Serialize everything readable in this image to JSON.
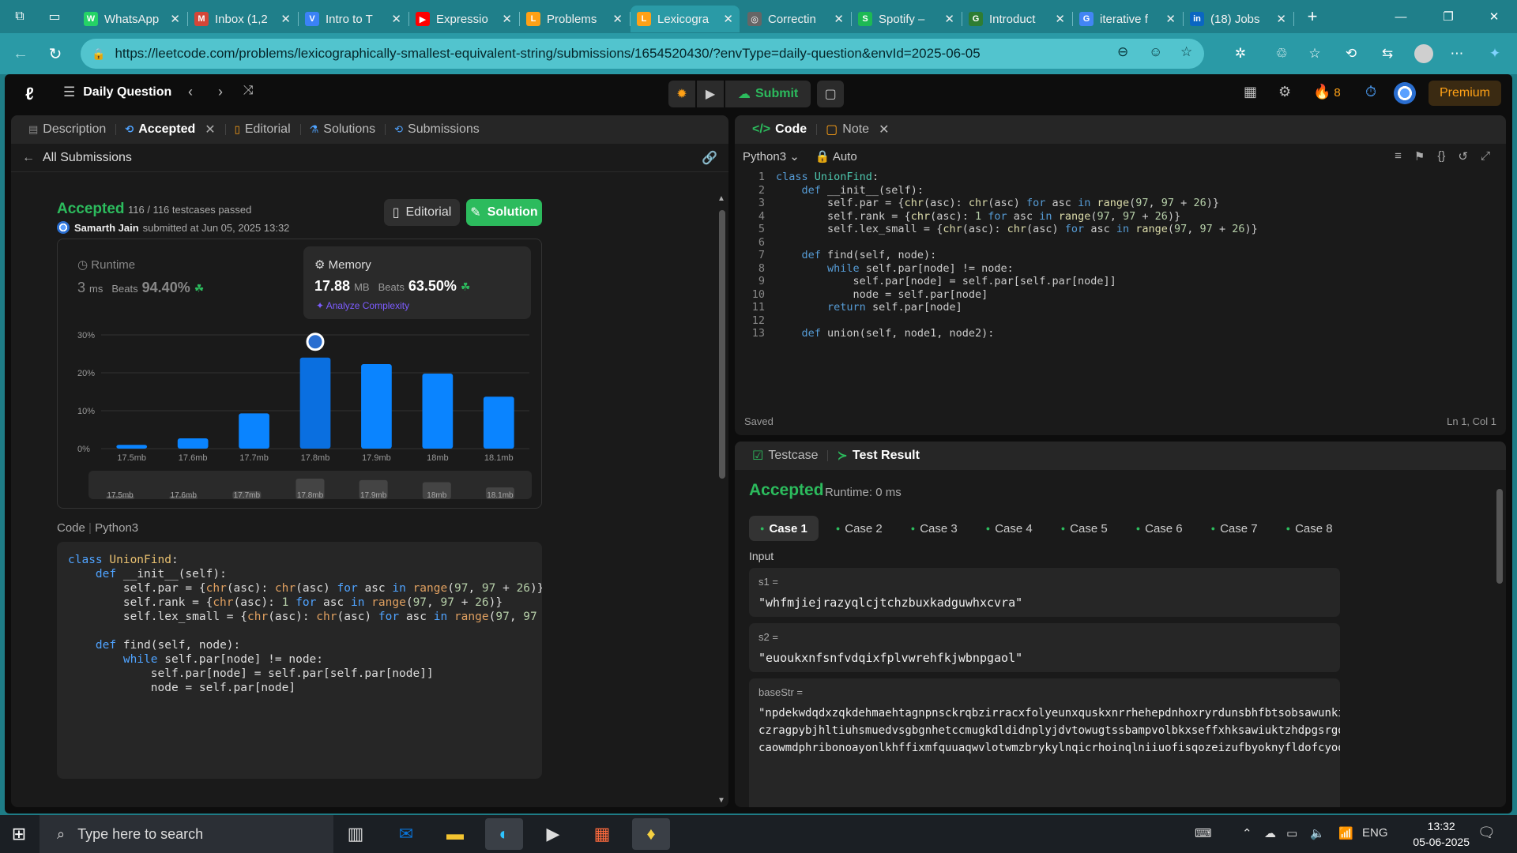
{
  "browser": {
    "tabs": [
      {
        "title": "WhatsApp",
        "favicon_color": "#25d366",
        "favicon": "W"
      },
      {
        "title": "Inbox (1,2",
        "favicon_color": "#d44638",
        "favicon": "M"
      },
      {
        "title": "Intro to T",
        "favicon_color": "#3b82f6",
        "favicon": "V"
      },
      {
        "title": "Expressio",
        "favicon_color": "#ff0000",
        "favicon": "▶"
      },
      {
        "title": "Problems",
        "favicon_color": "#ffa116",
        "favicon": "L"
      },
      {
        "title": "Lexicogra",
        "favicon_color": "#ffa116",
        "favicon": "L"
      },
      {
        "title": "Correctin",
        "favicon_color": "#666",
        "favicon": "◎"
      },
      {
        "title": "Spotify –",
        "favicon_color": "#1db954",
        "favicon": "S"
      },
      {
        "title": "Introduct",
        "favicon_color": "#2e7d32",
        "favicon": "G"
      },
      {
        "title": "iterative f",
        "favicon_color": "#4285f4",
        "favicon": "G"
      },
      {
        "title": "(18) Jobs",
        "favicon_color": "#0a66c2",
        "favicon": "in"
      }
    ],
    "active_tab_index": 5,
    "url": "https://leetcode.com/problems/lexicographically-smallest-equivalent-string/submissions/1654520430/?envType=daily-question&envId=2025-06-05"
  },
  "header": {
    "daily_question": "Daily Question",
    "submit_label": "Submit",
    "streak": "8",
    "premium": "Premium"
  },
  "left_panel": {
    "tabs": [
      {
        "label": "Description",
        "icon": "description-icon"
      },
      {
        "label": "Accepted",
        "icon": "history-icon"
      },
      {
        "label": "Editorial",
        "icon": "book-icon"
      },
      {
        "label": "Solutions",
        "icon": "flask-icon"
      },
      {
        "label": "Submissions",
        "icon": "history-icon"
      }
    ],
    "all_submissions": "All Submissions",
    "status": "Accepted",
    "testcases": "116 / 116 testcases passed",
    "user": "Samarth Jain",
    "submitted_at": "submitted at Jun 05, 2025 13:32",
    "editorial_btn": "Editorial",
    "solution_btn": "Solution",
    "runtime": {
      "label": "Runtime",
      "value": "3",
      "unit": "ms",
      "beats_label": "Beats",
      "beats": "94.40%"
    },
    "memory": {
      "label": "Memory",
      "value": "17.88",
      "unit": "MB",
      "beats_label": "Beats",
      "beats": "63.50%",
      "analyze": "Analyze Complexity"
    },
    "code_label": "Code",
    "code_lang": "Python3"
  },
  "chart_data": {
    "type": "bar",
    "categories": [
      "17.5mb",
      "17.6mb",
      "17.7mb",
      "17.8mb",
      "17.9mb",
      "18mb",
      "18.1mb"
    ],
    "values": [
      1,
      2.7,
      9.3,
      24,
      22.3,
      19.8,
      13.7
    ],
    "yticks": [
      "0%",
      "10%",
      "20%",
      "30%"
    ],
    "ylim": [
      0,
      30
    ],
    "highlight_category": "17.8mb",
    "bar_color": "#0a84ff",
    "grid": true
  },
  "code_editor": {
    "tabs": [
      "Code",
      "Note"
    ],
    "language": "Python3",
    "mode": "Auto",
    "saved": "Saved",
    "cursor": "Ln 1, Col 1",
    "lines": [
      "class UnionFind:",
      "    def __init__(self):",
      "        self.par = {chr(asc): chr(asc) for asc in range(97, 97 + 26)}",
      "        self.rank = {chr(asc): 1 for asc in range(97, 97 + 26)}",
      "        self.lex_small = {chr(asc): chr(asc) for asc in range(97, 97 + 26)}",
      "",
      "    def find(self, node):",
      "        while self.par[node] != node:",
      "            self.par[node] = self.par[self.par[node]]",
      "            node = self.par[node]",
      "        return self.par[node]",
      "",
      "    def union(self, node1, node2):"
    ]
  },
  "test_panel": {
    "tabs": [
      "Testcase",
      "Test Result"
    ],
    "status": "Accepted",
    "runtime": "Runtime: 0 ms",
    "cases": [
      "Case 1",
      "Case 2",
      "Case 3",
      "Case 4",
      "Case 5",
      "Case 6",
      "Case 7",
      "Case 8"
    ],
    "input_label": "Input",
    "inputs": [
      {
        "name": "s1 =",
        "value": "\"whfmjiejrazyqlcjtchzbuxkadguwhxcvra\""
      },
      {
        "name": "s2 =",
        "value": "\"euoukxnfsnfvdqixfplvwrehfkjwbnpgaol\""
      },
      {
        "name": "baseStr =",
        "value": "\"npdekwdqdxzqkdehmaehtagnpnsckrqbzirracxfolyeunxquskxnrrhehepdnhoxryrdunsbhfbtsobsawunkihqlhi\nczragpybjhltiuhsmuedvsgbgnhetccmugkdldidnplyjdvtowugtssbampvolbkxseffxhksawiuktzhdpgsrgowfvaz\ncaowmdphribonoayonlkhffixmfquuaqwvlotwmzbrykylnqicrhoinqlniiuofisqozeizufbyoknyfldofcyoqiio"
      }
    ]
  },
  "taskbar": {
    "search_placeholder": "Type here to search",
    "lang": "ENG",
    "time": "13:32",
    "date": "05-06-2025"
  }
}
